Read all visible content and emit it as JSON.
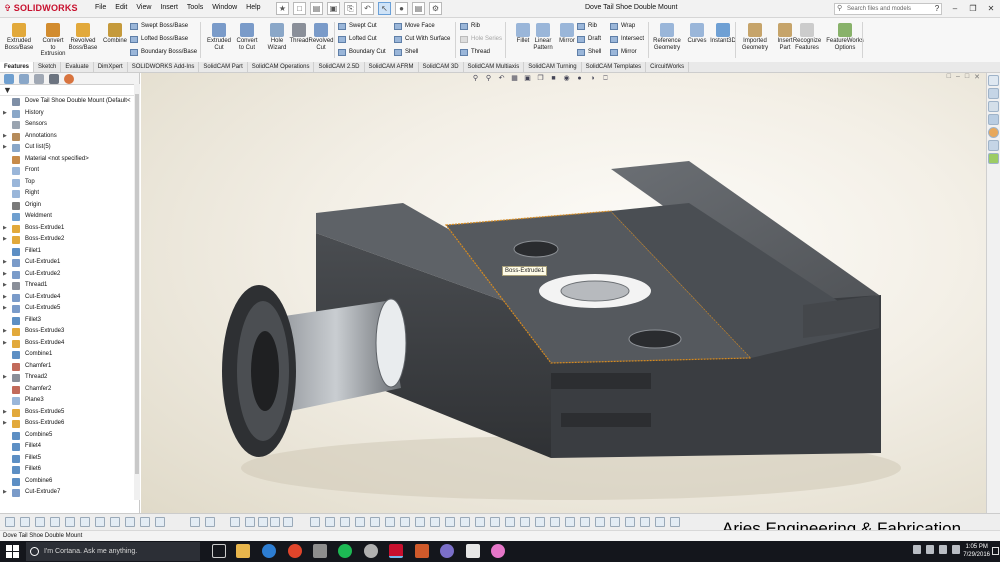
{
  "app": {
    "logo_text": "SOLIDWORKS",
    "document_title": "Dove Tail Shoe Double Mount"
  },
  "menus": [
    "File",
    "Edit",
    "View",
    "Insert",
    "Tools",
    "Window",
    "Help"
  ],
  "search": {
    "placeholder": "Search files and models"
  },
  "command_manager": {
    "large": [
      {
        "id": "extruded-boss",
        "label": "Extruded\nBoss/Base",
        "color": "#e2a93b"
      },
      {
        "id": "convert-to-extrusion",
        "label": "Convert\nto\nExtrusion",
        "color": "#d28c2f"
      },
      {
        "id": "revolved-boss",
        "label": "Revolved\nBoss/Base",
        "color": "#e2a93b"
      },
      {
        "id": "combine",
        "label": "Combine",
        "color": "#c59a3b"
      },
      {
        "id": "extruded-cut",
        "label": "Extruded\nCut",
        "color": "#7a9bc9"
      },
      {
        "id": "convert-to-cut",
        "label": "Convert\nto Cut",
        "color": "#7a9bc9"
      },
      {
        "id": "hole-wizard",
        "label": "Hole\nWizard",
        "color": "#8aa7c8"
      },
      {
        "id": "thread",
        "label": "Thread",
        "color": "#8a8f99"
      },
      {
        "id": "revolved-cut",
        "label": "Revolved\nCut",
        "color": "#7a9bc9"
      },
      {
        "id": "fillet",
        "label": "Fillet",
        "color": "#9ab6d9"
      },
      {
        "id": "linear-pattern",
        "label": "Linear\nPattern",
        "color": "#9ab6d9"
      },
      {
        "id": "mirror",
        "label": "Mirror",
        "color": "#9ab6d9"
      },
      {
        "id": "reference-geometry",
        "label": "Reference\nGeometry",
        "color": "#9ab6d9"
      },
      {
        "id": "curves",
        "label": "Curves",
        "color": "#9ab6d9"
      },
      {
        "id": "instant3d",
        "label": "Instant3D",
        "color": "#6fa0d4"
      },
      {
        "id": "imported-geometry",
        "label": "Imported\nGeometry",
        "color": "#c6a46a"
      },
      {
        "id": "insert-part",
        "label": "Insert\nPart",
        "color": "#c6a46a"
      },
      {
        "id": "recognize-features",
        "label": "Recognize\nFeatures",
        "color": "#cccccc"
      },
      {
        "id": "featureworks-options",
        "label": "FeatureWorks\nOptions",
        "color": "#88b26a"
      }
    ],
    "small": [
      {
        "id": "swept-boss",
        "label": "Swept Boss/Base",
        "dim": false
      },
      {
        "id": "lofted-boss",
        "label": "Lofted Boss/Base",
        "dim": false
      },
      {
        "id": "boundary-boss",
        "label": "Boundary Boss/Base",
        "dim": false
      },
      {
        "id": "swept-cut",
        "label": "Swept Cut",
        "dim": false
      },
      {
        "id": "lofted-cut",
        "label": "Lofted Cut",
        "dim": false
      },
      {
        "id": "boundary-cut",
        "label": "Boundary Cut",
        "dim": false
      },
      {
        "id": "move-face",
        "label": "Move Face",
        "dim": false
      },
      {
        "id": "cut-with-surface",
        "label": "Cut With Surface",
        "dim": false
      },
      {
        "id": "shell",
        "label": "Shell",
        "dim": false
      },
      {
        "id": "rib",
        "label": "Rib",
        "dim": false
      },
      {
        "id": "hole-series",
        "label": "Hole Series",
        "dim": true
      },
      {
        "id": "thread-small",
        "label": "Thread",
        "dim": false
      },
      {
        "id": "rib2",
        "label": "Rib",
        "dim": false
      },
      {
        "id": "draft",
        "label": "Draft",
        "dim": false
      },
      {
        "id": "shell2",
        "label": "Shell",
        "dim": false
      },
      {
        "id": "wrap",
        "label": "Wrap",
        "dim": false
      },
      {
        "id": "intersect",
        "label": "Intersect",
        "dim": false
      },
      {
        "id": "mirror-small",
        "label": "Mirror",
        "dim": false
      }
    ]
  },
  "tabs": [
    "Features",
    "Sketch",
    "Evaluate",
    "DimXpert",
    "SOLIDWORKS Add-Ins",
    "SolidCAM Part",
    "SolidCAM Operations",
    "SolidCAM 2.5D",
    "SolidCAM AFRM",
    "SolidCAM 3D",
    "SolidCAM Multiaxis",
    "SolidCAM Turning",
    "SolidCAM Templates",
    "CircuitWorks"
  ],
  "active_tab": "Features",
  "feature_tree": [
    {
      "label": "Dove Tail Shoe Double Mount  (Default<",
      "icon": "part",
      "arrow": false
    },
    {
      "label": "History",
      "icon": "history",
      "arrow": true
    },
    {
      "label": "Sensors",
      "icon": "sensor",
      "arrow": false
    },
    {
      "label": "Annotations",
      "icon": "annotation",
      "arrow": true
    },
    {
      "label": "Cut list(5)",
      "icon": "cutlist",
      "arrow": true
    },
    {
      "label": "Material <not specified>",
      "icon": "material",
      "arrow": false
    },
    {
      "label": "Front",
      "icon": "plane",
      "arrow": false
    },
    {
      "label": "Top",
      "icon": "plane",
      "arrow": false
    },
    {
      "label": "Right",
      "icon": "plane",
      "arrow": false
    },
    {
      "label": "Origin",
      "icon": "origin",
      "arrow": false
    },
    {
      "label": "Weldment",
      "icon": "weldment",
      "arrow": false
    },
    {
      "label": "Boss-Extrude1",
      "icon": "boss",
      "arrow": true
    },
    {
      "label": "Boss-Extrude2",
      "icon": "boss",
      "arrow": true
    },
    {
      "label": "Fillet1",
      "icon": "fillet",
      "arrow": false
    },
    {
      "label": "Cut-Extrude1",
      "icon": "cut",
      "arrow": true
    },
    {
      "label": "Cut-Extrude2",
      "icon": "cut",
      "arrow": true
    },
    {
      "label": "Thread1",
      "icon": "thread",
      "arrow": true
    },
    {
      "label": "Cut-Extrude4",
      "icon": "cut",
      "arrow": true
    },
    {
      "label": "Cut-Extrude5",
      "icon": "cut",
      "arrow": true
    },
    {
      "label": "Fillet3",
      "icon": "fillet",
      "arrow": false
    },
    {
      "label": "Boss-Extrude3",
      "icon": "boss",
      "arrow": true
    },
    {
      "label": "Boss-Extrude4",
      "icon": "boss",
      "arrow": true
    },
    {
      "label": "Combine1",
      "icon": "combine",
      "arrow": false
    },
    {
      "label": "Chamfer1",
      "icon": "chamfer",
      "arrow": false
    },
    {
      "label": "Thread2",
      "icon": "thread",
      "arrow": true
    },
    {
      "label": "Chamfer2",
      "icon": "chamfer",
      "arrow": false
    },
    {
      "label": "Plane3",
      "icon": "plane",
      "arrow": false
    },
    {
      "label": "Boss-Extrude5",
      "icon": "boss",
      "arrow": true
    },
    {
      "label": "Boss-Extrude6",
      "icon": "boss",
      "arrow": true
    },
    {
      "label": "Combine5",
      "icon": "combine",
      "arrow": false
    },
    {
      "label": "Fillet4",
      "icon": "fillet",
      "arrow": false
    },
    {
      "label": "Fillet5",
      "icon": "fillet",
      "arrow": false
    },
    {
      "label": "Fillet6",
      "icon": "fillet",
      "arrow": false
    },
    {
      "label": "Combine6",
      "icon": "combine",
      "arrow": false
    },
    {
      "label": "Cut-Extrude7",
      "icon": "cut",
      "arrow": true
    }
  ],
  "icon_colors": {
    "part": "#7f8fa6",
    "history": "#8aa7c8",
    "sensor": "#9aa4b0",
    "annotation": "#b68b5a",
    "cutlist": "#8aa7c8",
    "material": "#c78b4a",
    "plane": "#9ab6d9",
    "origin": "#7a7a7a",
    "weldment": "#6f9fcf",
    "boss": "#e2a93b",
    "fillet": "#5d8fc4",
    "cut": "#7a9bc9",
    "thread": "#8a8f99",
    "combine": "#5d8fc4",
    "chamfer": "#c26a5a"
  },
  "viewport": {
    "tooltip": "Boss-Extrude1",
    "model_color": "#4d5054",
    "highlight_color": "#d58a20"
  },
  "watermark": "Aries Engineering & Fabrication",
  "statusbar": {
    "text": "Dove Tail Shoe Double Mount"
  },
  "taskbar": {
    "cortana_placeholder": "I'm Cortana. Ask me anything.",
    "time": "1:05 PM",
    "date": "7/29/2016"
  }
}
